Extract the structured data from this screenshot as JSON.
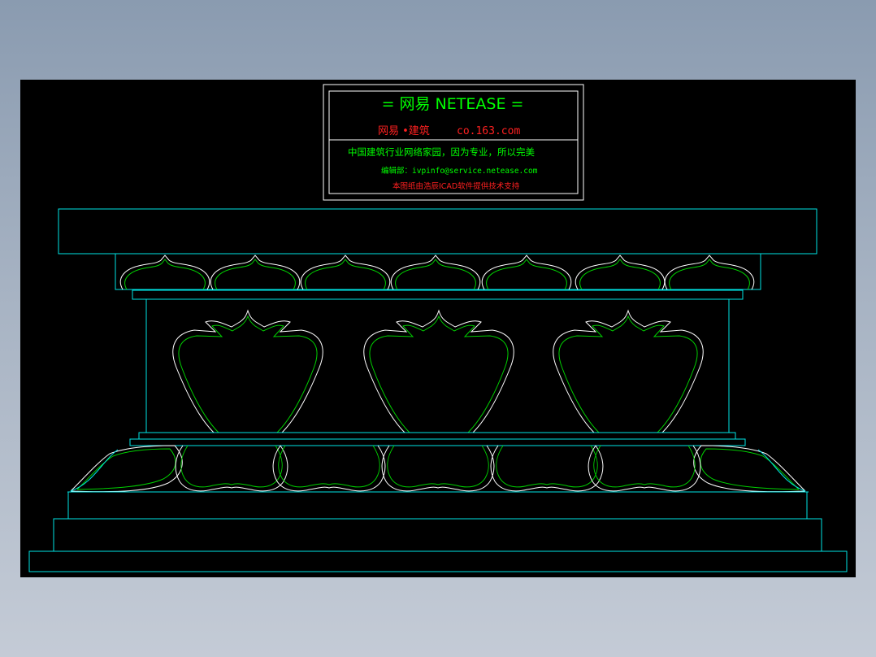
{
  "title_block": {
    "heading": "= 网易  NETEASE =",
    "subtitle_cn": "网易 •建筑",
    "subtitle_url": "co.163.com",
    "slogan": "中国建筑行业网络家园，因为专业，所以完美",
    "editor": "编辑部：ivpinfo@service.netease.com",
    "support": "本图纸由浩辰ICAD软件提供技术支持"
  },
  "colors": {
    "background": "#000000",
    "outline": "#00e5e5",
    "ornament_white": "#ffffff",
    "ornament_green": "#00d000",
    "title_green": "#00ff00",
    "title_red": "#ff2020",
    "frame": "#ffffff"
  }
}
